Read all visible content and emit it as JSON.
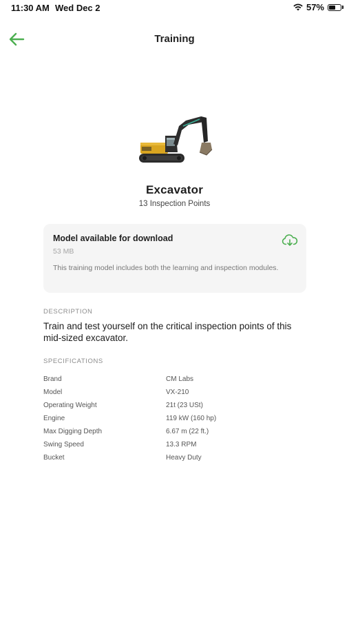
{
  "status_bar": {
    "time": "11:30 AM",
    "date": "Wed Dec 2",
    "battery": "57%",
    "battery_level": 0.57
  },
  "nav": {
    "title": "Training"
  },
  "model": {
    "name": "Excavator",
    "inspection_points": "13 Inspection Points"
  },
  "download_card": {
    "title": "Model available for download",
    "size": "53 MB",
    "description": "This training model includes both the learning and inspection modules."
  },
  "description": {
    "heading": "DESCRIPTION",
    "text": "Train and test yourself on the critical inspection points of this mid-sized excavator."
  },
  "specifications": {
    "heading": "SPECIFICATIONS",
    "rows": [
      {
        "key": "Brand",
        "value": "CM Labs"
      },
      {
        "key": "Model",
        "value": "VX-210"
      },
      {
        "key": "Operating Weight",
        "value": "21t  (23 USt)"
      },
      {
        "key": "Engine",
        "value": "119 kW (160 hp)"
      },
      {
        "key": "Max Digging Depth",
        "value": "6.67 m (22 ft.)"
      },
      {
        "key": "Swing Speed",
        "value": "13.3 RPM"
      },
      {
        "key": "Bucket",
        "value": "Heavy Duty"
      }
    ]
  },
  "colors": {
    "accent": "#4caf50",
    "card_bg": "#f5f5f5"
  },
  "icons": [
    "back-arrow-icon",
    "wifi-icon",
    "battery-icon",
    "cloud-download-icon"
  ]
}
